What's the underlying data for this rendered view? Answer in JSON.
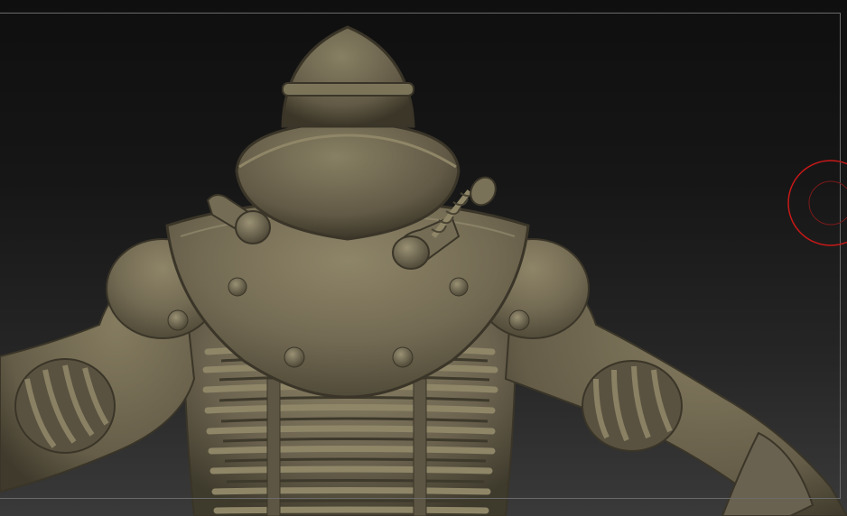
{
  "viewport": {
    "background_top": "#0f0f0f",
    "background_bottom": "#3a3a3a",
    "frame_color": "#6a6a6a"
  },
  "model": {
    "material_base": "#6f6650",
    "material_highlight": "#8f8668",
    "material_shadow": "#3b3628",
    "icon": "armored-diver-sculpt-icon"
  },
  "brush_cursor": {
    "color": "#c81818",
    "icon": "brush-cursor-icon"
  }
}
